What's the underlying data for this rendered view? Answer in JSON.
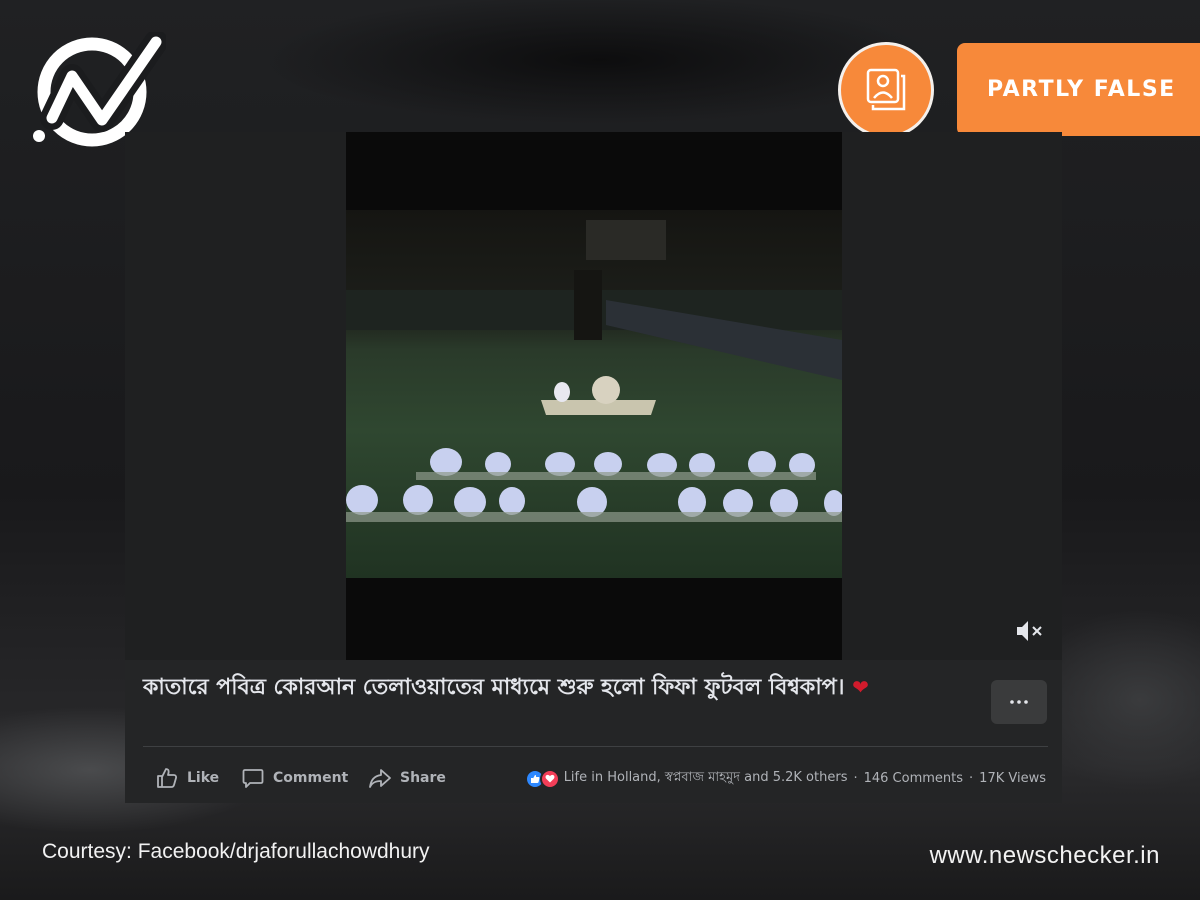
{
  "fact_check": {
    "rating": "PARTLY FALSE",
    "accent_color": "#f7893a",
    "rating_icon": "photo-frame-icon",
    "brand_logo_icon": "newschecker-check-logo-icon"
  },
  "post": {
    "caption_text": "কাতারে পবিত্র কোরআন তেলাওয়াতের মাধ্যমে শুরু হলো ফিফা ফুটবল বিশ্বকাপ।",
    "caption_emoji": "❤",
    "more_label": "···",
    "actions": {
      "like": "Like",
      "comment": "Comment",
      "share": "Share"
    },
    "reactions_text": "Life in Holland, স্বপ্নবাজ মাহমুদ and 5.2K others",
    "comments_count": "146 Comments",
    "views_count": "17K Views",
    "separator": "·"
  },
  "footer": {
    "courtesy": "Courtesy: Facebook/drjaforullachowdhury",
    "website": "www.newschecker.in"
  }
}
